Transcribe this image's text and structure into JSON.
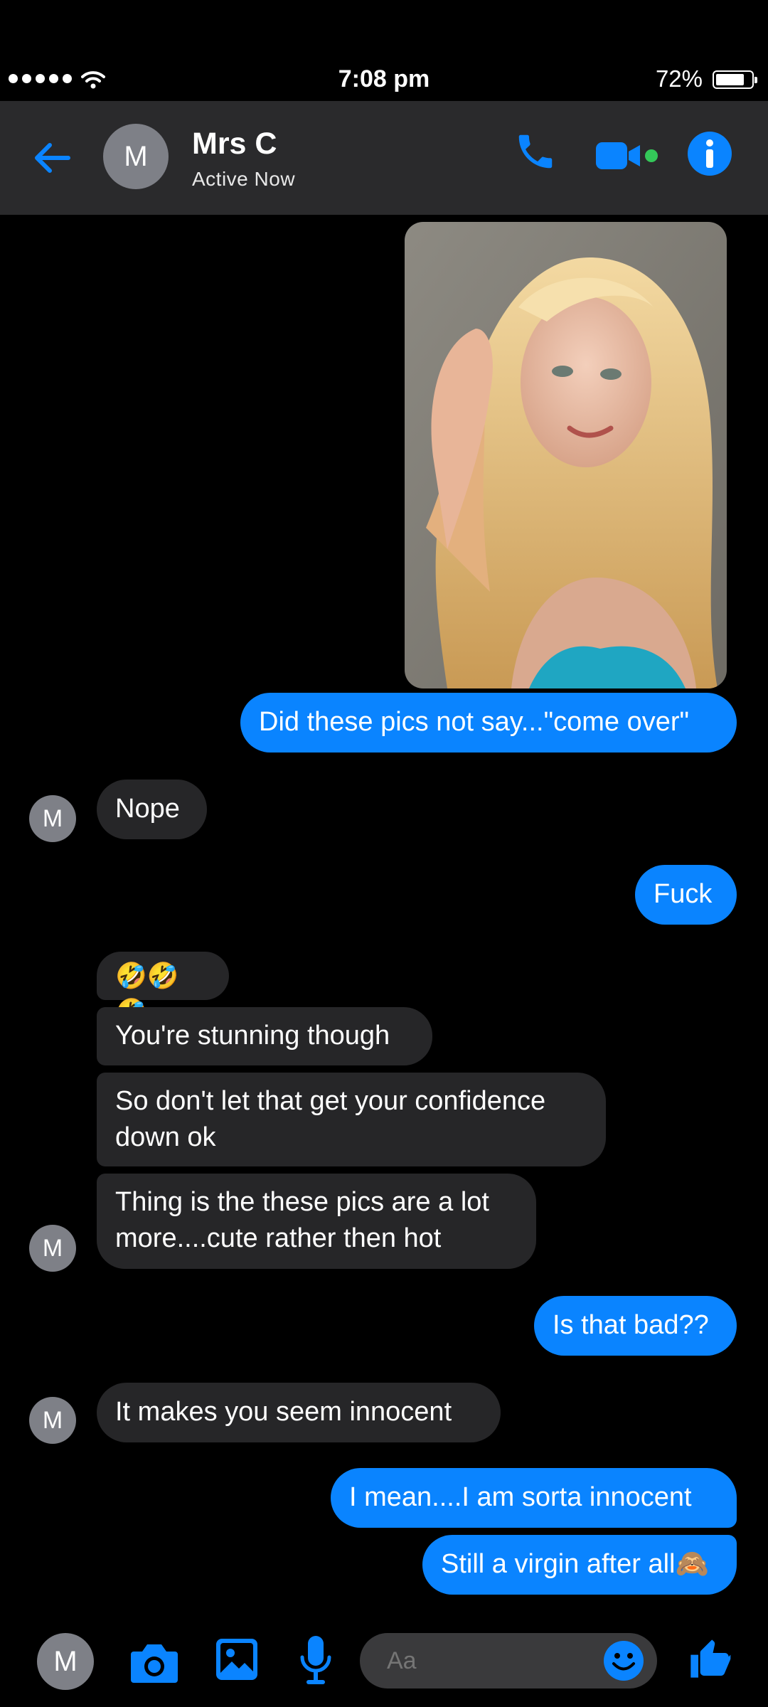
{
  "status": {
    "time": "7:08 pm",
    "battery": "72%"
  },
  "header": {
    "avatar_letter": "M",
    "name": "Mrs C",
    "status": "Active Now"
  },
  "messages": [
    {
      "from": "me",
      "text": "Did these pics not say...\"come over\""
    },
    {
      "from": "them",
      "text": "Nope"
    },
    {
      "from": "me",
      "text": "Fuck"
    },
    {
      "from": "them",
      "text": "🤣🤣🤣"
    },
    {
      "from": "them",
      "text": "You're stunning though"
    },
    {
      "from": "them",
      "text": "So don't let that get your confidence down ok"
    },
    {
      "from": "them",
      "text": "Thing is the these pics are a lot more....cute rather then hot"
    },
    {
      "from": "me",
      "text": "Is that bad??"
    },
    {
      "from": "them",
      "text": "It makes you seem innocent"
    },
    {
      "from": "me",
      "text": "I mean....I am sorta innocent"
    },
    {
      "from": "me",
      "text": "Still a virgin after all🙈"
    }
  ],
  "composer": {
    "avatar_letter": "M",
    "placeholder": "Aa"
  },
  "colors": {
    "accent": "#0a84ff",
    "incoming_bubble": "#262628",
    "header_bg": "#2a2a2c",
    "online": "#34c759"
  },
  "icons": [
    "back-arrow-icon",
    "phone-icon",
    "video-camera-icon",
    "info-icon",
    "camera-icon",
    "gallery-icon",
    "microphone-icon",
    "emoji-icon",
    "thumbs-up-icon"
  ]
}
